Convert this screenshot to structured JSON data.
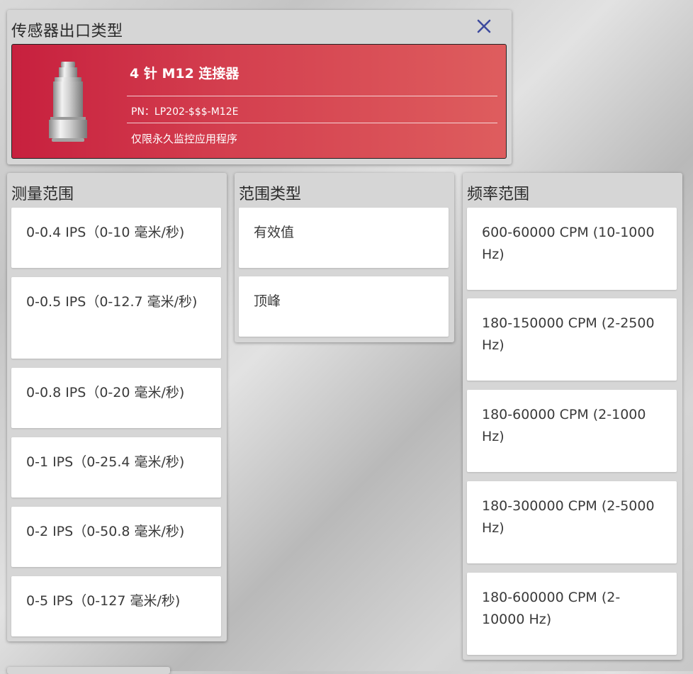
{
  "sensor_panel": {
    "title": "传感器出口类型",
    "close_icon": "close-icon",
    "product": {
      "name": "4 针 M12 连接器",
      "pn": "PN：LP202-$$$-M12E",
      "note": "仅限永久监控应用程序",
      "image_icon": "sensor-image"
    }
  },
  "columns": {
    "measurement": {
      "title": "测量范围",
      "options": [
        "0-0.4 IPS（0-10 毫米/秒)",
        "0-0.5 IPS（0-12.7 毫米/秒)",
        "0-0.8 IPS（0-20 毫米/秒)",
        "0-1 IPS（0-25.4 毫米/秒)",
        "0-2 IPS（0-50.8 毫米/秒)",
        "0-5 IPS（0-127 毫米/秒)"
      ]
    },
    "range_type": {
      "title": "范围类型",
      "options": [
        "有效值",
        "顶峰"
      ]
    },
    "frequency": {
      "title": "频率范围",
      "options": [
        "600-60000 CPM (10-1000 Hz)",
        "180-150000 CPM (2-2500 Hz)",
        "180-60000 CPM (2-1000 Hz)",
        "180-300000 CPM (2-5000 Hz)",
        "180-600000 CPM (2-10000 Hz)"
      ]
    }
  },
  "colors": {
    "card_gradient_start": "#c7203e",
    "card_gradient_end": "#de5d5e",
    "close_icon": "#3d4a9e",
    "panel_bg": "#d6d6d6"
  }
}
